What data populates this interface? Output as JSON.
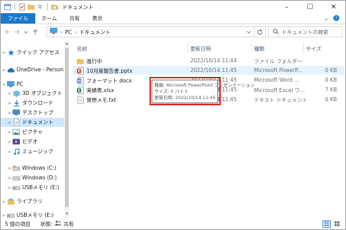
{
  "window": {
    "title": "ドキュメント",
    "controls": {
      "minimize": "–",
      "maximize": "☐",
      "close": "✕"
    }
  },
  "ribbon": {
    "tabs": [
      "ファイル",
      "ホーム",
      "共有",
      "表示"
    ],
    "expand_glyph": "⌄",
    "help_glyph": "?"
  },
  "address": {
    "segments": [
      "PC",
      "ドキュメント"
    ],
    "separator": "›",
    "search_placeholder": "ドキュメントの検索"
  },
  "nav": {
    "items": [
      {
        "label": "クイック アクセス",
        "icon": "star-icon",
        "chevron": ">",
        "indent": 0
      },
      {
        "label": "OneDrive - Person",
        "icon": "cloud-icon",
        "chevron": ">",
        "indent": 0
      },
      {
        "label": "PC",
        "icon": "pc-icon",
        "chevron": "v",
        "indent": 0
      },
      {
        "label": "3D オブジェクト",
        "icon": "cube-icon",
        "chevron": ">",
        "indent": 1
      },
      {
        "label": "ダウンロード",
        "icon": "download-icon",
        "chevron": ">",
        "indent": 1
      },
      {
        "label": "デスクトップ",
        "icon": "desktop-icon",
        "chevron": ">",
        "indent": 1
      },
      {
        "label": "ドキュメント",
        "icon": "document-folder-icon",
        "chevron": ">",
        "indent": 1,
        "selected": true
      },
      {
        "label": "ピクチャ",
        "icon": "picture-icon",
        "chevron": ">",
        "indent": 1
      },
      {
        "label": "ビデオ",
        "icon": "video-icon",
        "chevron": ">",
        "indent": 1
      },
      {
        "label": "ミュージック",
        "icon": "music-icon",
        "chevron": ">",
        "indent": 1
      },
      {
        "label": "Windows (C:)",
        "icon": "drive-icon",
        "chevron": ">",
        "indent": 1
      },
      {
        "label": "Windows (D:)",
        "icon": "drive-icon",
        "chevron": ">",
        "indent": 1
      },
      {
        "label": "USBメモリ (E:)",
        "icon": "usb-drive-icon",
        "chevron": ">",
        "indent": 1
      },
      {
        "label": "ライブラリ",
        "icon": "library-icon",
        "chevron": ">",
        "indent": 0
      },
      {
        "label": "USBメモリ (E:)",
        "icon": "usb-drive-icon",
        "chevron": ">",
        "indent": 0
      }
    ]
  },
  "list": {
    "columns": {
      "name": "名前",
      "date": "更新日時",
      "type": "種類",
      "size": "サイズ"
    },
    "rows": [
      {
        "name": "進行中",
        "date": "2022/10/14 11:44",
        "type": "ファイル フォルダー",
        "size": "",
        "icon": "folder-icon"
      },
      {
        "name": "10月度報告書.pptx",
        "date": "2022/10/14 11:45",
        "type": "Microsoft PowerP...",
        "size": "0 KB",
        "icon": "powerpoint-icon",
        "hover": true
      },
      {
        "name": "フォーマット.docx",
        "date": "2022/10/14 11:45",
        "type": "Microsoft Word ...",
        "size": "0 KB",
        "icon": "word-icon"
      },
      {
        "name": "実績表.xlsx",
        "date": "2022/10/14 11:45",
        "type": "Microsoft Excel ワ...",
        "size": "7 KB",
        "icon": "excel-icon"
      },
      {
        "name": "発想メモ.txt",
        "date": "2022/10/14 11:45",
        "type": "テキスト ドキュメント",
        "size": "0 KB",
        "icon": "text-file-icon"
      }
    ]
  },
  "tooltip": {
    "line1": "種類: Microsoft PowerPoint プレゼンテーション",
    "line2": "サイズ: 0 バイト",
    "line3": "更新日時: 2022/10/14 11:45"
  },
  "status": {
    "count": "5 個の項目",
    "state_label": "状態:",
    "state_value": "共有"
  },
  "colors": {
    "file_tab": "#1979ca",
    "selection": "#cce8ff",
    "hover_row": "#e5f3ff",
    "highlight_box": "#e01b1b",
    "folder": "#f3c34f",
    "powerpoint": "#c43e1c",
    "word": "#2b579a",
    "excel": "#217346"
  }
}
